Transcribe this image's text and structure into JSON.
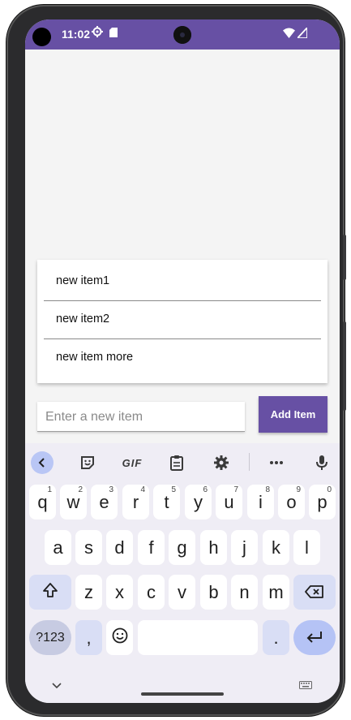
{
  "status_bar": {
    "time": "11:02",
    "icons": [
      "gear-icon",
      "sd-card-icon",
      "wifi-icon",
      "signal-icon"
    ],
    "color": "#6750a4"
  },
  "list": {
    "items": [
      {
        "label": "new item1"
      },
      {
        "label": "new item2"
      },
      {
        "label": "new item more"
      }
    ]
  },
  "input": {
    "placeholder": "Enter a new item",
    "value": ""
  },
  "add_button": {
    "label": "Add Item",
    "color": "#6750a4"
  },
  "keyboard": {
    "toolbar": {
      "gif_label": "GIF",
      "icons": [
        "back-chevron-icon",
        "sticker-icon",
        "gif-icon",
        "clipboard-icon",
        "settings-icon",
        "more-icon",
        "microphone-icon"
      ]
    },
    "row1": [
      {
        "key": "q",
        "num": "1"
      },
      {
        "key": "w",
        "num": "2"
      },
      {
        "key": "e",
        "num": "3"
      },
      {
        "key": "r",
        "num": "4"
      },
      {
        "key": "t",
        "num": "5"
      },
      {
        "key": "y",
        "num": "6"
      },
      {
        "key": "u",
        "num": "7"
      },
      {
        "key": "i",
        "num": "8"
      },
      {
        "key": "o",
        "num": "9"
      },
      {
        "key": "p",
        "num": "0"
      }
    ],
    "row2": [
      "a",
      "s",
      "d",
      "f",
      "g",
      "h",
      "j",
      "k",
      "l"
    ],
    "row3": [
      "z",
      "x",
      "c",
      "v",
      "b",
      "n",
      "m"
    ],
    "sym_label": "?123",
    "comma_label": ",",
    "period_label": "."
  }
}
